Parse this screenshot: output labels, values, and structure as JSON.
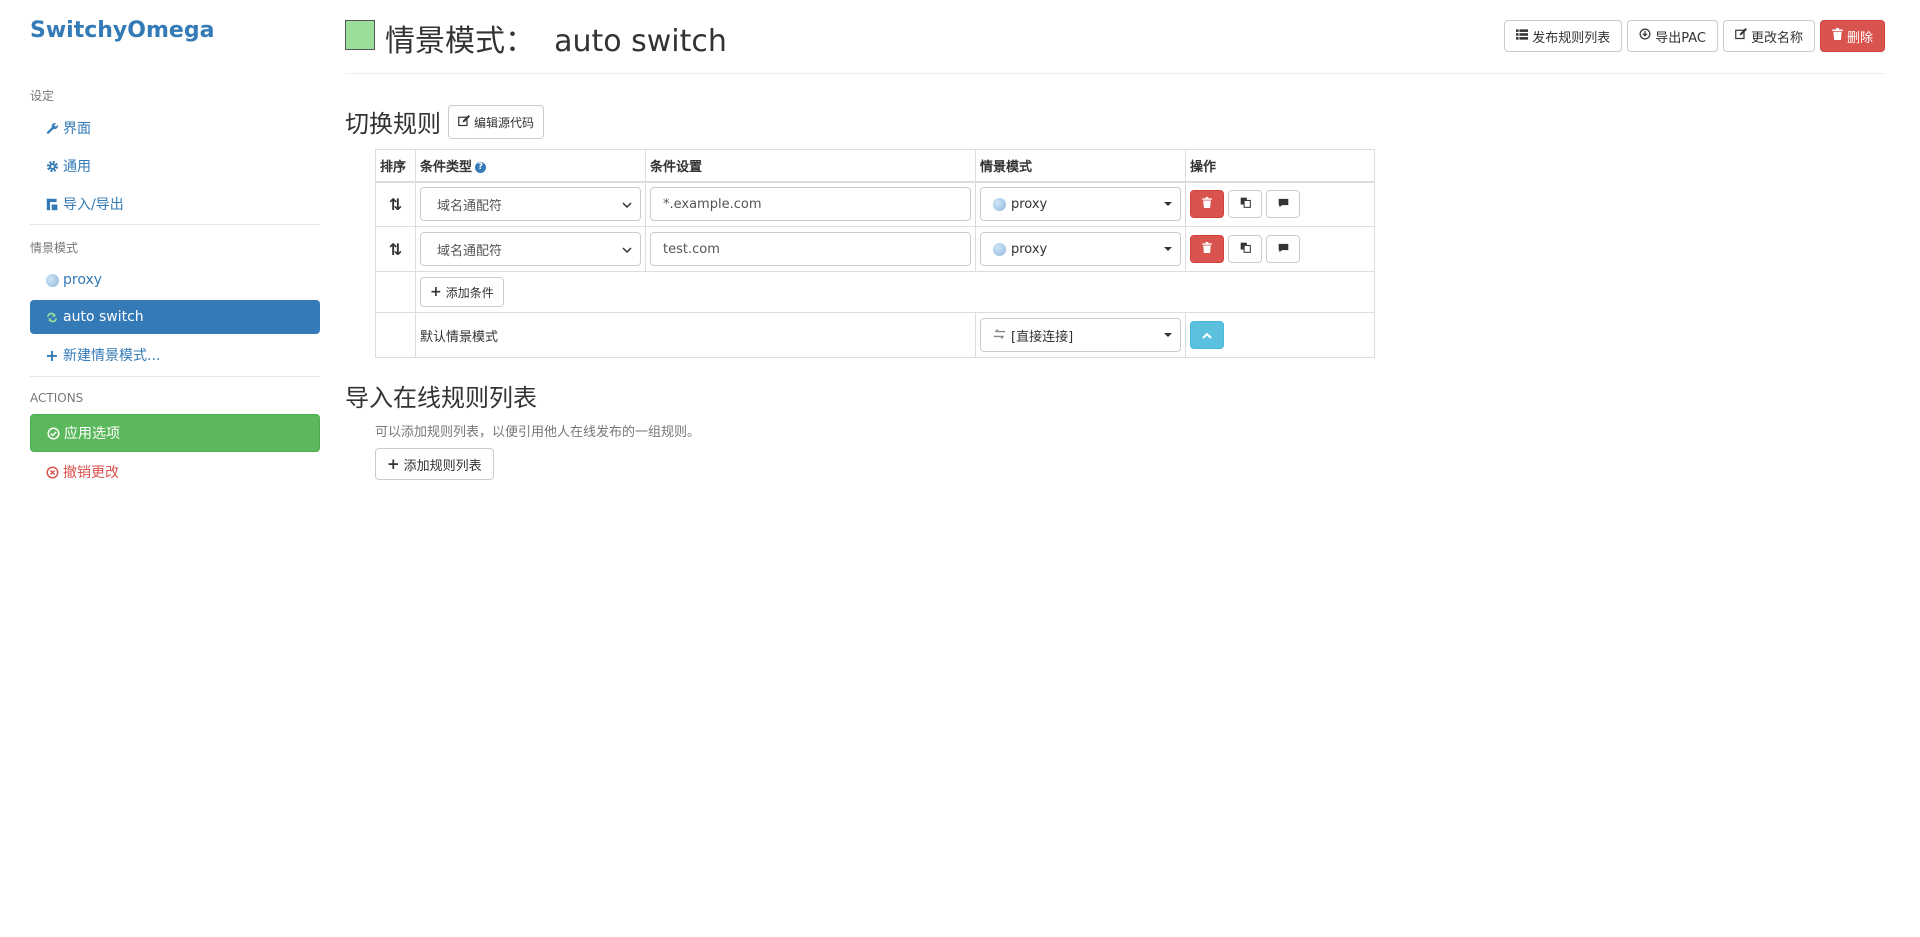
{
  "sidebar": {
    "brand": "SwitchyOmega",
    "settings_header": "设定",
    "settings_items": [
      {
        "label": "界面",
        "icon": "wrench-icon"
      },
      {
        "label": "通用",
        "icon": "gear-icon"
      },
      {
        "label": "导入/导出",
        "icon": "import-export-icon"
      }
    ],
    "profiles_header": "情景模式",
    "profiles": [
      {
        "label": "proxy",
        "icon": "globe-icon"
      },
      {
        "label": "auto switch",
        "icon": "refresh-icon",
        "active": true
      }
    ],
    "new_profile": "新建情景模式...",
    "actions_header": "ACTIONS",
    "apply": "应用选项",
    "discard": "撤销更改"
  },
  "header": {
    "title": "情景模式：  auto switch",
    "profile_color": "#99dd99",
    "buttons": {
      "publish": "发布规则列表",
      "export_pac": "导出PAC",
      "rename": "更改名称",
      "delete": "删除"
    }
  },
  "rules": {
    "title": "切换规则",
    "edit_source": "编辑源代码",
    "columns": {
      "sort": "排序",
      "condition_type": "条件类型",
      "condition": "条件设置",
      "profile": "情景模式",
      "actions": "操作"
    },
    "rows": [
      {
        "condition_type": "域名通配符",
        "condition": "*.example.com",
        "profile": "proxy"
      },
      {
        "condition_type": "域名通配符",
        "condition": "test.com",
        "profile": "proxy"
      }
    ],
    "add_condition": "添加条件",
    "default_label": "默认情景模式",
    "default_profile": "[直接连接]"
  },
  "online_rules": {
    "title": "导入在线规则列表",
    "description": "可以添加规则列表，以便引用他人在线发布的一组规则。",
    "add_button": "添加规则列表"
  },
  "colors": {
    "primary": "#337ab7",
    "success": "#5cb85c",
    "danger": "#d9534f",
    "info": "#5bc0de"
  }
}
